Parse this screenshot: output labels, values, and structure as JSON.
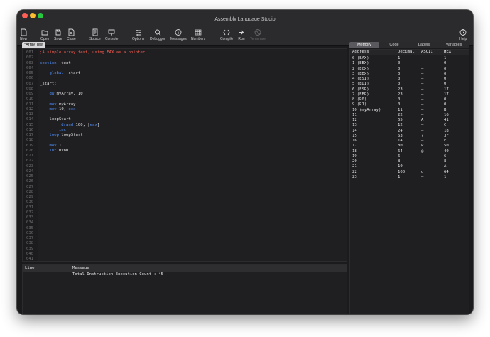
{
  "app": {
    "title": "Assembly Language Studio",
    "tab": "*Array Test"
  },
  "toolbar": [
    {
      "label": "New",
      "icon": "new-document-icon"
    },
    {
      "label": "Open",
      "icon": "folder-icon"
    },
    {
      "label": "Save",
      "icon": "save-icon"
    },
    {
      "label": "Close",
      "icon": "close-document-icon"
    },
    {
      "label": "Source",
      "icon": "source-icon"
    },
    {
      "label": "Console",
      "icon": "monitor-icon"
    },
    {
      "label": "Options",
      "icon": "options-icon"
    },
    {
      "label": "Debugger",
      "icon": "debugger-icon"
    },
    {
      "label": "Messages",
      "icon": "info-icon"
    },
    {
      "label": "Numbers",
      "icon": "numbers-icon"
    },
    {
      "label": "Compile",
      "icon": "compile-icon"
    },
    {
      "label": "Run",
      "icon": "run-icon"
    },
    {
      "label": "Terminate",
      "icon": "terminate-icon"
    },
    {
      "label": "Help",
      "icon": "help-icon"
    }
  ],
  "colors": {
    "comment": "#ff5b4f",
    "keyword": "#4f8fff",
    "register": "#e2e2e4"
  },
  "editor": {
    "lines": [
      {
        "num": "001",
        "parts": [
          {
            "t": ";A simple array test, using EAX as a pointer.",
            "c": "comment"
          }
        ]
      },
      {
        "num": "002",
        "parts": []
      },
      {
        "num": "003",
        "parts": [
          {
            "t": "section",
            "c": "keyword"
          },
          {
            "t": " .text",
            "c": "plain"
          }
        ]
      },
      {
        "num": "004",
        "parts": []
      },
      {
        "num": "005",
        "parts": [
          {
            "t": "    global",
            "c": "keyword"
          },
          {
            "t": " _start",
            "c": "plain"
          }
        ]
      },
      {
        "num": "006",
        "parts": []
      },
      {
        "num": "007",
        "parts": [
          {
            "t": "_start:",
            "c": "plain"
          }
        ]
      },
      {
        "num": "008",
        "parts": []
      },
      {
        "num": "009",
        "parts": [
          {
            "t": "    dw",
            "c": "keyword"
          },
          {
            "t": " myArray, 10",
            "c": "plain"
          }
        ]
      },
      {
        "num": "010",
        "parts": []
      },
      {
        "num": "011",
        "parts": [
          {
            "t": "    mov",
            "c": "keyword"
          },
          {
            "t": " myArray",
            "c": "plain"
          }
        ]
      },
      {
        "num": "012",
        "parts": [
          {
            "t": "    mov",
            "c": "keyword"
          },
          {
            "t": " 10, ",
            "c": "plain"
          },
          {
            "t": "ecx",
            "c": "keyword"
          }
        ]
      },
      {
        "num": "013",
        "parts": []
      },
      {
        "num": "014",
        "parts": [
          {
            "t": "    loopStart:",
            "c": "plain"
          }
        ]
      },
      {
        "num": "015",
        "parts": [
          {
            "t": "        rdrand",
            "c": "keyword"
          },
          {
            "t": " 100, [",
            "c": "plain"
          },
          {
            "t": "eax",
            "c": "keyword"
          },
          {
            "t": "]",
            "c": "plain"
          }
        ]
      },
      {
        "num": "016",
        "parts": [
          {
            "t": "        inc",
            "c": "keyword"
          }
        ]
      },
      {
        "num": "017",
        "parts": [
          {
            "t": "    loop",
            "c": "keyword"
          },
          {
            "t": " loopStart",
            "c": "plain"
          }
        ]
      },
      {
        "num": "018",
        "parts": []
      },
      {
        "num": "019",
        "parts": [
          {
            "t": "    mov",
            "c": "keyword"
          },
          {
            "t": " 1",
            "c": "plain"
          }
        ]
      },
      {
        "num": "020",
        "parts": [
          {
            "t": "    int",
            "c": "keyword"
          },
          {
            "t": " 0x80",
            "c": "plain"
          }
        ]
      },
      {
        "num": "021",
        "parts": []
      },
      {
        "num": "022",
        "parts": []
      },
      {
        "num": "023",
        "parts": []
      },
      {
        "num": "024",
        "parts": []
      },
      {
        "num": "025",
        "parts": []
      },
      {
        "num": "026",
        "parts": []
      },
      {
        "num": "027",
        "parts": []
      },
      {
        "num": "028",
        "parts": []
      },
      {
        "num": "029",
        "parts": []
      },
      {
        "num": "030",
        "parts": []
      },
      {
        "num": "031",
        "parts": []
      },
      {
        "num": "032",
        "parts": []
      },
      {
        "num": "033",
        "parts": []
      },
      {
        "num": "034",
        "parts": []
      },
      {
        "num": "035",
        "parts": []
      },
      {
        "num": "036",
        "parts": []
      },
      {
        "num": "037",
        "parts": []
      },
      {
        "num": "038",
        "parts": []
      },
      {
        "num": "039",
        "parts": []
      },
      {
        "num": "040",
        "parts": []
      },
      {
        "num": "041",
        "parts": []
      }
    ]
  },
  "messages": {
    "headers": {
      "line": "Line",
      "message": "Message"
    },
    "rows": [
      {
        "line": "-",
        "message": "Total Instruction Execution Count : 45"
      }
    ]
  },
  "right_tabs": [
    {
      "label": "Memory",
      "active": true
    },
    {
      "label": "Code",
      "active": false
    },
    {
      "label": "Labels",
      "active": false
    },
    {
      "label": "Variables",
      "active": false
    }
  ],
  "memory": {
    "headers": {
      "address": "Address",
      "decimal": "Decimal",
      "ascii": "ASCII",
      "hex": "HEX"
    },
    "rows": [
      {
        "address": "0 (EAX)",
        "decimal": "1",
        "ascii": "–",
        "hex": "1"
      },
      {
        "address": "1 (EBX)",
        "decimal": "0",
        "ascii": "–",
        "hex": "0"
      },
      {
        "address": "2 (ECX)",
        "decimal": "0",
        "ascii": "–",
        "hex": "0"
      },
      {
        "address": "3 (EDX)",
        "decimal": "0",
        "ascii": "–",
        "hex": "0"
      },
      {
        "address": "4 (ESI)",
        "decimal": "0",
        "ascii": "–",
        "hex": "0"
      },
      {
        "address": "5 (EDI)",
        "decimal": "0",
        "ascii": "–",
        "hex": "0"
      },
      {
        "address": "6 (ESP)",
        "decimal": "23",
        "ascii": "–",
        "hex": "17"
      },
      {
        "address": "7 (EBP)",
        "decimal": "23",
        "ascii": "–",
        "hex": "17"
      },
      {
        "address": "8 (R0)",
        "decimal": "0",
        "ascii": "–",
        "hex": "0"
      },
      {
        "address": "9 (R1)",
        "decimal": "0",
        "ascii": "–",
        "hex": "0"
      },
      {
        "address": "10 (myArray)",
        "decimal": "11",
        "ascii": "–",
        "hex": "B"
      },
      {
        "address": "11",
        "decimal": "22",
        "ascii": "–",
        "hex": "16"
      },
      {
        "address": "12",
        "decimal": "65",
        "ascii": "A",
        "hex": "41"
      },
      {
        "address": "13",
        "decimal": "12",
        "ascii": "–",
        "hex": "C"
      },
      {
        "address": "14",
        "decimal": "24",
        "ascii": "–",
        "hex": "18"
      },
      {
        "address": "15",
        "decimal": "63",
        "ascii": "?",
        "hex": "3F"
      },
      {
        "address": "16",
        "decimal": "14",
        "ascii": "–",
        "hex": "E"
      },
      {
        "address": "17",
        "decimal": "80",
        "ascii": "P",
        "hex": "50"
      },
      {
        "address": "18",
        "decimal": "64",
        "ascii": "@",
        "hex": "40"
      },
      {
        "address": "19",
        "decimal": "6",
        "ascii": "–",
        "hex": "6"
      },
      {
        "address": "20",
        "decimal": "8",
        "ascii": "–",
        "hex": "8"
      },
      {
        "address": "21",
        "decimal": "10",
        "ascii": "–",
        "hex": "A"
      },
      {
        "address": "22",
        "decimal": "100",
        "ascii": "d",
        "hex": "64"
      },
      {
        "address": "23",
        "decimal": "1",
        "ascii": "–",
        "hex": "1"
      }
    ]
  }
}
